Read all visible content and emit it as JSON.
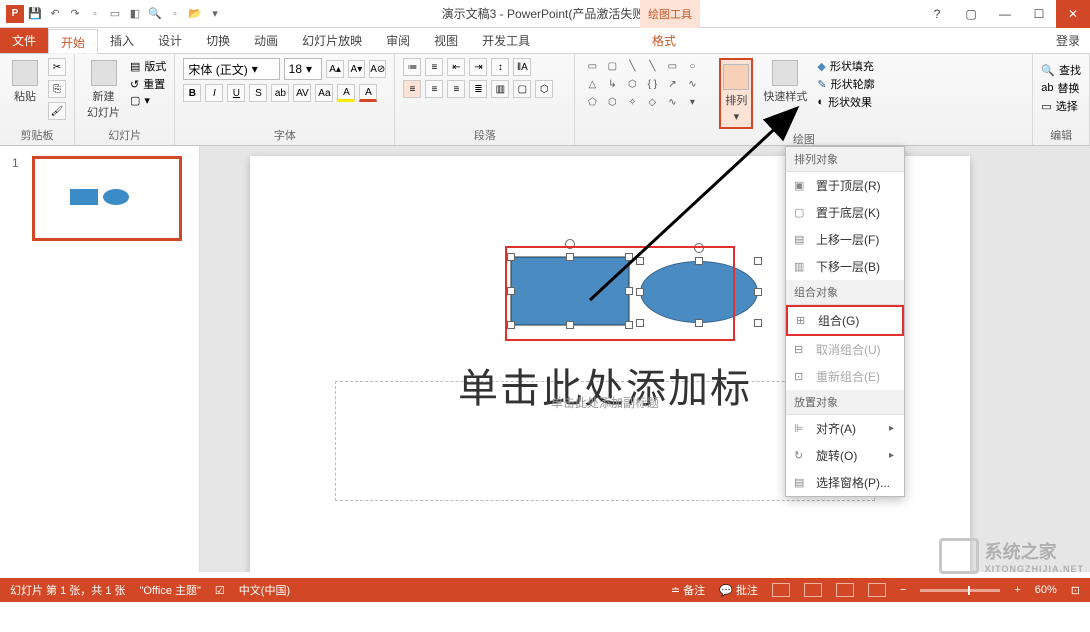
{
  "title": "演示文稿3 - PowerPoint(产品激活失败)",
  "contextual_tab_group": "绘图工具",
  "tabs": {
    "file": "文件",
    "home": "开始",
    "insert": "插入",
    "design": "设计",
    "transitions": "切换",
    "animations": "动画",
    "slideshow": "幻灯片放映",
    "review": "审阅",
    "view": "视图",
    "developer": "开发工具",
    "format": "格式"
  },
  "login": "登录",
  "ribbon": {
    "clipboard": {
      "paste": "粘贴",
      "label": "剪贴板"
    },
    "slides": {
      "new": "新建\n幻灯片",
      "layout": "版式",
      "reset": "重置",
      "label": "幻灯片"
    },
    "font": {
      "family": "宋体 (正文)",
      "size": "18",
      "label": "字体"
    },
    "paragraph": {
      "label": "段落"
    },
    "drawing": {
      "arrange": "排列",
      "quick": "快速样式",
      "fill": "形状填充",
      "outline": "形状轮廓",
      "effects": "形状效果",
      "label": "绘图"
    },
    "editing": {
      "find": "查找",
      "replace": "替换",
      "select": "选择",
      "label": "编辑"
    }
  },
  "menu": {
    "section1": "排列对象",
    "bring_front": "置于顶层(R)",
    "send_back": "置于底层(K)",
    "bring_fwd": "上移一层(F)",
    "send_bwd": "下移一层(B)",
    "section2": "组合对象",
    "group": "组合(G)",
    "ungroup": "取消组合(U)",
    "regroup": "重新组合(E)",
    "section3": "放置对象",
    "align": "对齐(A)",
    "rotate": "旋转(O)",
    "pane": "选择窗格(P)..."
  },
  "slide": {
    "number": "1",
    "title_placeholder": "单击此处添加标",
    "subtitle_placeholder": "单击此处添加副标题"
  },
  "status": {
    "slide_info": "幻灯片 第 1 张，共 1 张",
    "theme": "\"Office 主题\"",
    "lang": "中文(中国)",
    "notes": "备注",
    "comments": "批注",
    "zoom": "60%"
  },
  "watermark": {
    "text1": "系统之家",
    "text2": "XITONGZHIJIA.NET"
  }
}
